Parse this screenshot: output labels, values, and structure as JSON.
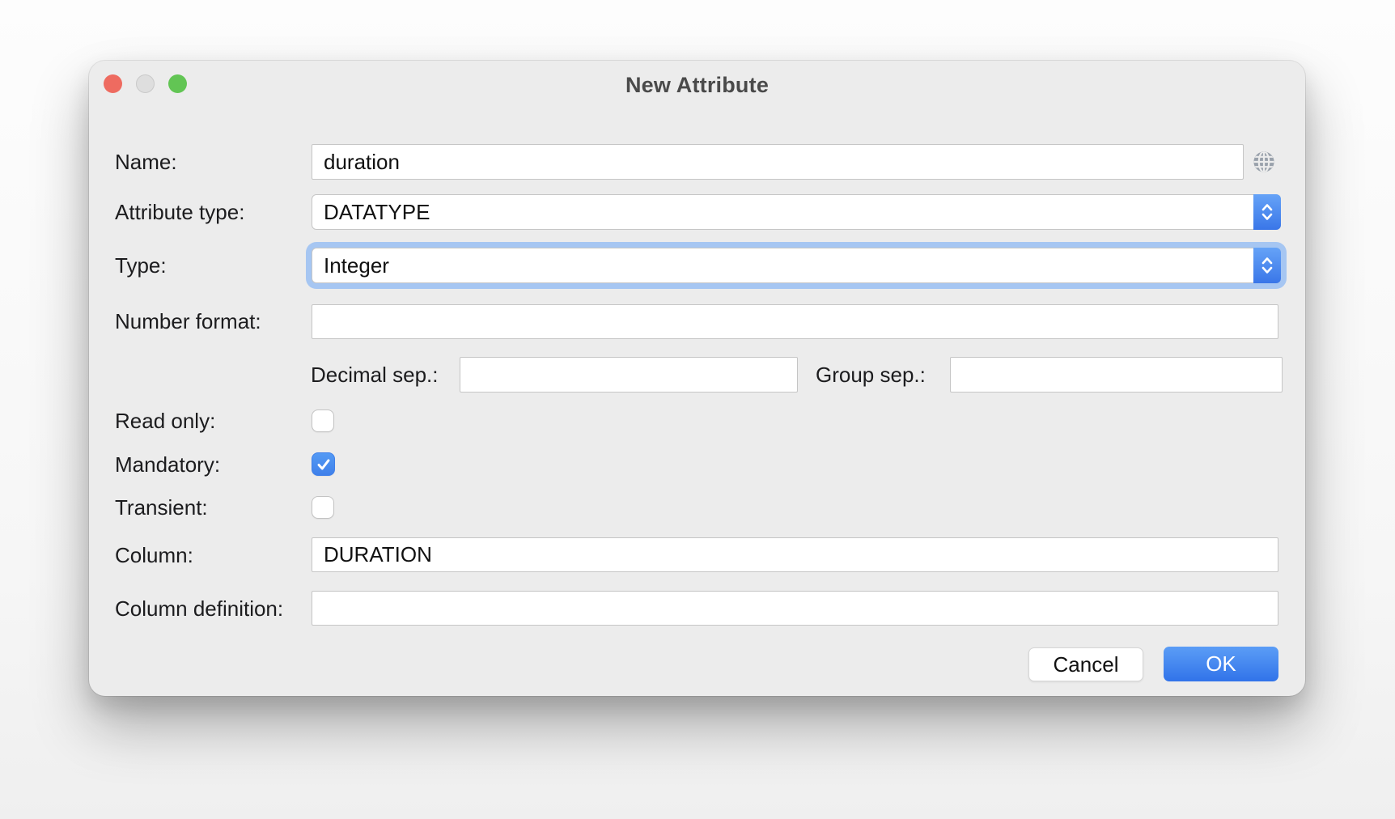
{
  "window": {
    "title": "New Attribute",
    "traffic_lights": {
      "close": "close",
      "minimize": "minimize",
      "zoom": "zoom"
    }
  },
  "form": {
    "name": {
      "label": "Name:",
      "value": "duration"
    },
    "attribute_type": {
      "label": "Attribute type:",
      "value": "DATATYPE"
    },
    "type": {
      "label": "Type:",
      "value": "Integer",
      "focused": true
    },
    "number_format": {
      "label": "Number format:",
      "value": ""
    },
    "decimal_sep": {
      "label": "Decimal sep.:",
      "value": ""
    },
    "group_sep": {
      "label": "Group sep.:",
      "value": ""
    },
    "read_only": {
      "label": "Read only:",
      "checked": false
    },
    "mandatory": {
      "label": "Mandatory:",
      "checked": true
    },
    "transient": {
      "label": "Transient:",
      "checked": false
    },
    "column": {
      "label": "Column:",
      "value": "DURATION"
    },
    "column_definition": {
      "label": "Column definition:",
      "value": ""
    }
  },
  "buttons": {
    "cancel": "Cancel",
    "ok": "OK"
  },
  "icons": {
    "name_trailing": "globe-icon",
    "dropdown_control": "up-down-chevrons-icon",
    "checkbox_mark": "checkmark-icon"
  },
  "colors": {
    "dialog_background": "#ececec",
    "accent_blue": "#3b7ce8",
    "focus_ring": "#a6c6f2",
    "checkbox_checked": "#4a8cec",
    "traffic_close": "#ee6b60",
    "traffic_minimize": "#dedede",
    "traffic_zoom": "#62c554"
  }
}
